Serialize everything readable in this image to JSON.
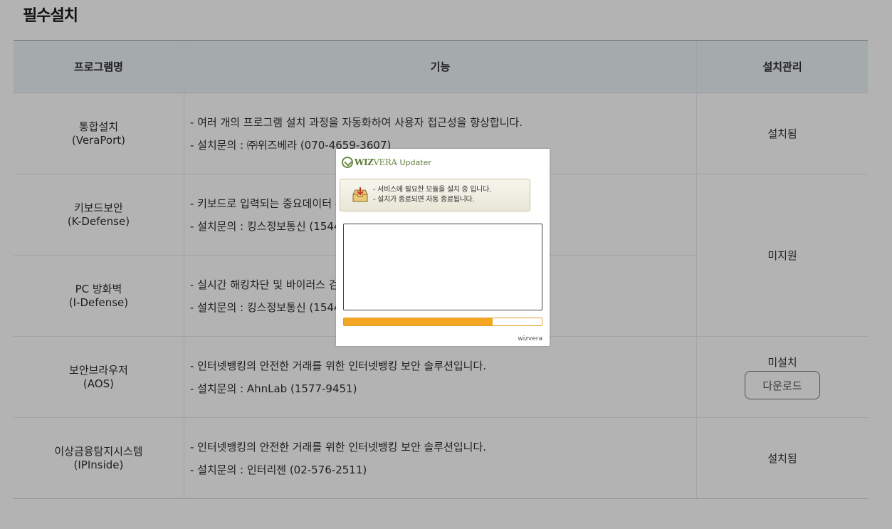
{
  "page": {
    "title": "필수설치"
  },
  "table": {
    "headers": {
      "name": "프로그램명",
      "function": "기능",
      "status": "설치관리"
    },
    "rows": [
      {
        "name": "통합설치",
        "name_en": "(VeraPort)",
        "func1": "- 여러 개의 프로그램 설치 과정을 자동화하여 사용자 접근성을 향상합니다.",
        "func2": "- 설치문의 : ㈜위즈베라 (070-4659-3607)",
        "status": "설치됨"
      },
      {
        "name": "키보드보안",
        "name_en": "(K-Defense)",
        "func1": "- 키보드로 입력되는 중요데이터 유",
        "func2": "- 설치문의 : 킹스정보통신 (1544",
        "status": "미지원"
      },
      {
        "name": "PC 방화벽",
        "name_en": "(I-Defense)",
        "func1": "- 실시간 해킹차단 및 바이러스 검",
        "func2": "- 설치문의 : 킹스정보통신 (1544"
      },
      {
        "name": "보안브라우저",
        "name_en": "(AOS)",
        "func1": "- 인터넷뱅킹의 안전한 거래를 위한 인터넷뱅킹 보안 솔루션입니다.",
        "func2": "- 설치문의 : AhnLab (1577-9451)",
        "status": "미설치",
        "button": "다운로드"
      },
      {
        "name": "이상금융탐지시스템",
        "name_en": "(IPInside)",
        "func1": "- 인터넷뱅킹의 안전한 거래를 위한 인터넷뱅킹 보안 솔루션입니다.",
        "func2": "- 설치문의 : 인터리젠 (02-576-2511)",
        "status": "설치됨"
      }
    ]
  },
  "updater": {
    "logo_bold": "WIZ",
    "logo_light": "VERA",
    "title": "Updater",
    "message_line1": "- 서비스에 필요한 모듈을 설치 중 입니다.",
    "message_line2": "- 설치가 종료되면 자동 종료됩니다.",
    "progress_fraction": 0.75,
    "footer": "wizvera",
    "accent": "#f5a623",
    "brand_color": "#5c7a3a"
  }
}
